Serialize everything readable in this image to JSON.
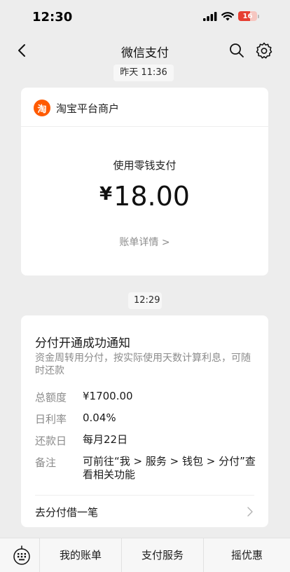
{
  "status_bar": {
    "time": "12:30",
    "battery": "16"
  },
  "nav": {
    "title": "微信支付"
  },
  "messages": [
    {
      "timestamp": "昨天 11:36",
      "merchant_logo_text": "淘",
      "merchant_name": "淘宝平台商户",
      "pay_method": "使用零钱支付",
      "currency": "¥",
      "amount": "18.00",
      "detail_link": "账单详情 >"
    },
    {
      "timestamp": "12:29",
      "title": "分付开通成功通知",
      "description": "资金周转用分付，按实际使用天数计算利息，可随时还款",
      "rows": [
        {
          "label": "总额度",
          "value": "¥1700.00"
        },
        {
          "label": "日利率",
          "value": "0.04%"
        },
        {
          "label": "还款日",
          "value": "每月22日"
        },
        {
          "label": "备注",
          "value": "可前往“我 > 服务 > 钱包 > 分付”查看相关功能"
        }
      ],
      "link_label": "去分付借一笔"
    }
  ],
  "bottom_menu": [
    {
      "label": "我的账单"
    },
    {
      "label": "支付服务"
    },
    {
      "label": "摇优惠"
    }
  ],
  "icons": {
    "back": "chevron-left-icon",
    "search": "search-icon",
    "settings": "gear-icon",
    "keyboard": "keyboard-icon"
  },
  "colors": {
    "background": "#ededed",
    "card": "#ffffff",
    "merchant_logo": "#ff5a00",
    "battery": "#e63f32"
  }
}
